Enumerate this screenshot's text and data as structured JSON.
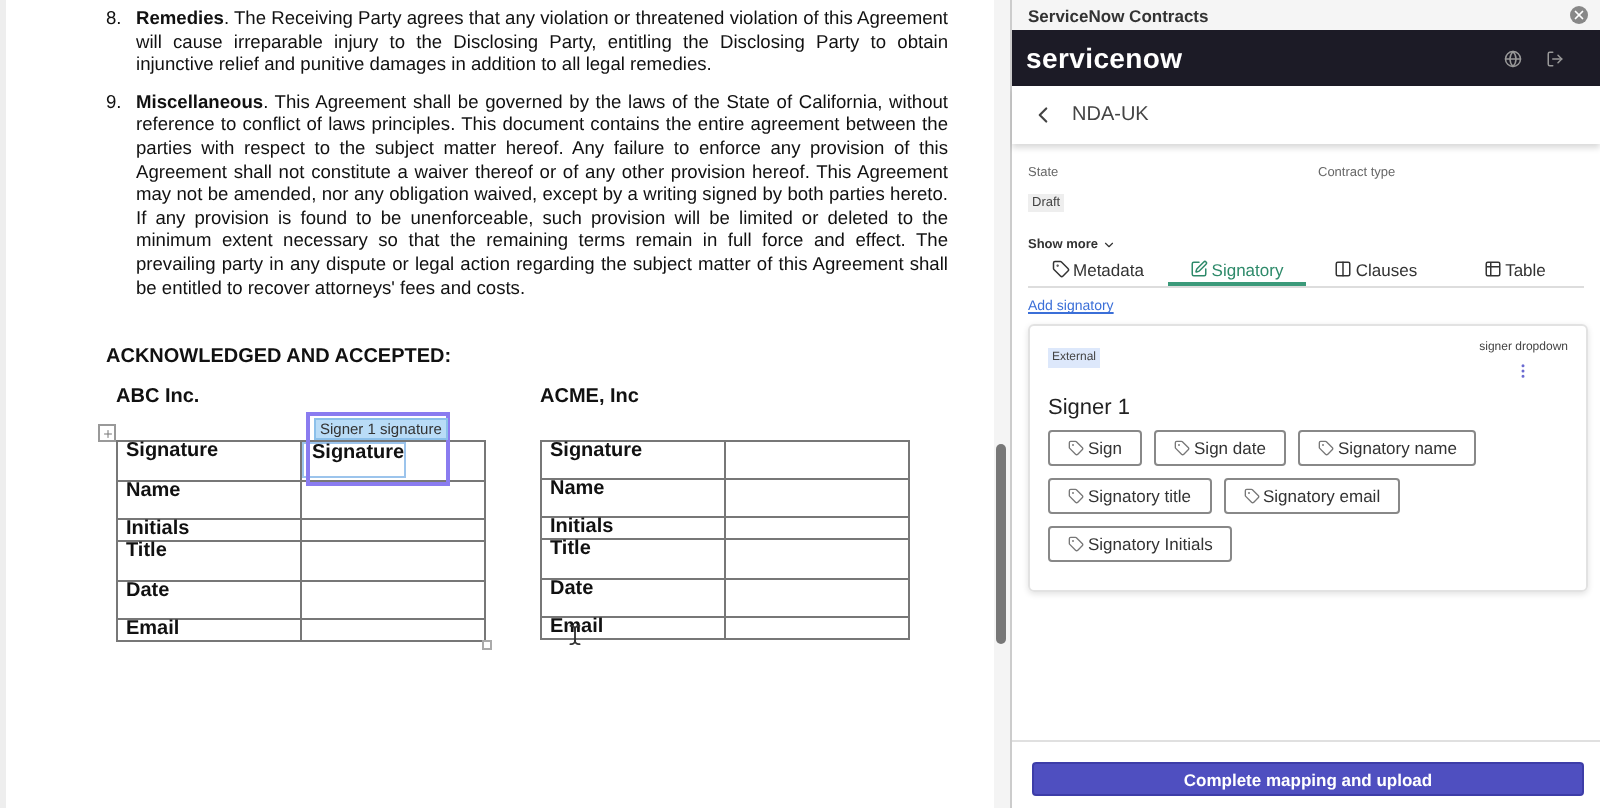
{
  "document": {
    "paragraphs": [
      {
        "number": "8.",
        "text": "**Remedies**.  The Receiving Party agrees that any violation or threatened violation of this Agreement will cause irreparable injury to the Disclosing Party, entitling the Disclosing Party to obtain injunctive relief and punitive damages in addition to all legal remedies."
      },
      {
        "number": "9.",
        "text": "**Miscellaneous**.  This Agreement shall be governed by the laws of the State of California, without reference to conflict of laws principles.  This document contains the entire agreement between the parties with respect to the subject matter hereof.  Any failure to enforce any provision of this Agreement shall not constitute a waiver thereof or of any other provision hereof.  This Agreement may not be amended, nor any obligation waived, except by a writing signed by both parties hereto. If any provision is found to be unenforceable, such provision will be limited or deleted to the minimum extent necessary so that the remaining terms remain in full force and effect. The prevailing party in any dispute or legal action regarding the subject matter of this Agreement shall be entitled to recover attorneys' fees and costs."
      }
    ],
    "heading": "ACKNOWLEDGED AND ACCEPTED:",
    "parties": [
      {
        "name": "ABC Inc.",
        "placed_field": {
          "label": "Signer 1 signature",
          "text": "Signature"
        },
        "rows": [
          "Signature",
          "Name",
          "Initials",
          "Title",
          "Date",
          "Email"
        ]
      },
      {
        "name": "ACME, Inc",
        "rows": [
          "Signature",
          "Name",
          "Initials",
          "Title",
          "Date",
          "Email"
        ]
      }
    ]
  },
  "panel": {
    "title": "ServiceNow Contracts",
    "brand": "servicenow",
    "record": "NDA-UK",
    "fields": [
      {
        "label": "State",
        "value": "Draft"
      },
      {
        "label": "Contract type"
      }
    ],
    "show_more": "Show more",
    "tabs": [
      {
        "label": "Metadata",
        "selected": false
      },
      {
        "label": "Signatory",
        "selected": true
      },
      {
        "label": "Clauses",
        "selected": false
      },
      {
        "label": "Table",
        "selected": false
      }
    ],
    "add_link": "Add signatory",
    "signer": {
      "badge": "External",
      "dropdown_label": "signer dropdown",
      "name": "Signer 1",
      "chips": [
        "Sign",
        "Sign date",
        "Signatory name",
        "Signatory title",
        "Signatory email",
        "Signatory Initials"
      ]
    },
    "primary_button": "Complete mapping and upload"
  }
}
